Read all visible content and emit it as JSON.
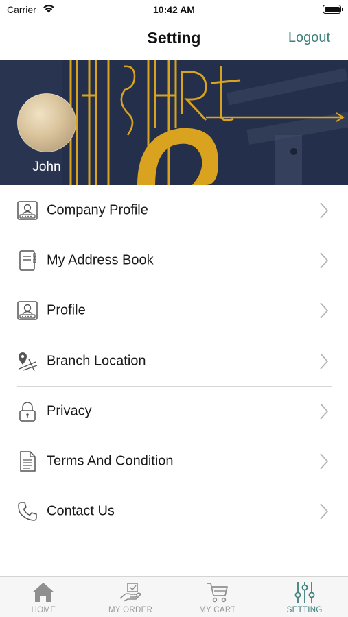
{
  "status_bar": {
    "carrier": "Carrier",
    "time": "10:42 AM"
  },
  "nav": {
    "title": "Setting",
    "logout_label": "Logout"
  },
  "profile": {
    "name": "John"
  },
  "menu": {
    "items": [
      {
        "label": "Company Profile",
        "icon": "company-card-icon"
      },
      {
        "label": "My Address Book",
        "icon": "address-book-icon"
      },
      {
        "label": "Profile",
        "icon": "profile-card-icon"
      },
      {
        "label": "Branch Location",
        "icon": "map-pin-icon"
      },
      {
        "label": "Privacy",
        "icon": "lock-icon"
      },
      {
        "label": "Terms And Condition",
        "icon": "document-icon"
      },
      {
        "label": "Contact Us",
        "icon": "phone-icon"
      }
    ]
  },
  "tabs": [
    {
      "label": "HOME",
      "icon": "home-icon"
    },
    {
      "label": "MY ORDER",
      "icon": "order-icon"
    },
    {
      "label": "MY CART",
      "icon": "cart-icon"
    },
    {
      "label": "SETTING",
      "icon": "sliders-icon",
      "active": true
    }
  ],
  "colors": {
    "accent": "#3f7f7a",
    "banner_bg": "#24304b",
    "banner_gold": "#d9a21f",
    "tab_inactive": "#9a9a9a"
  }
}
